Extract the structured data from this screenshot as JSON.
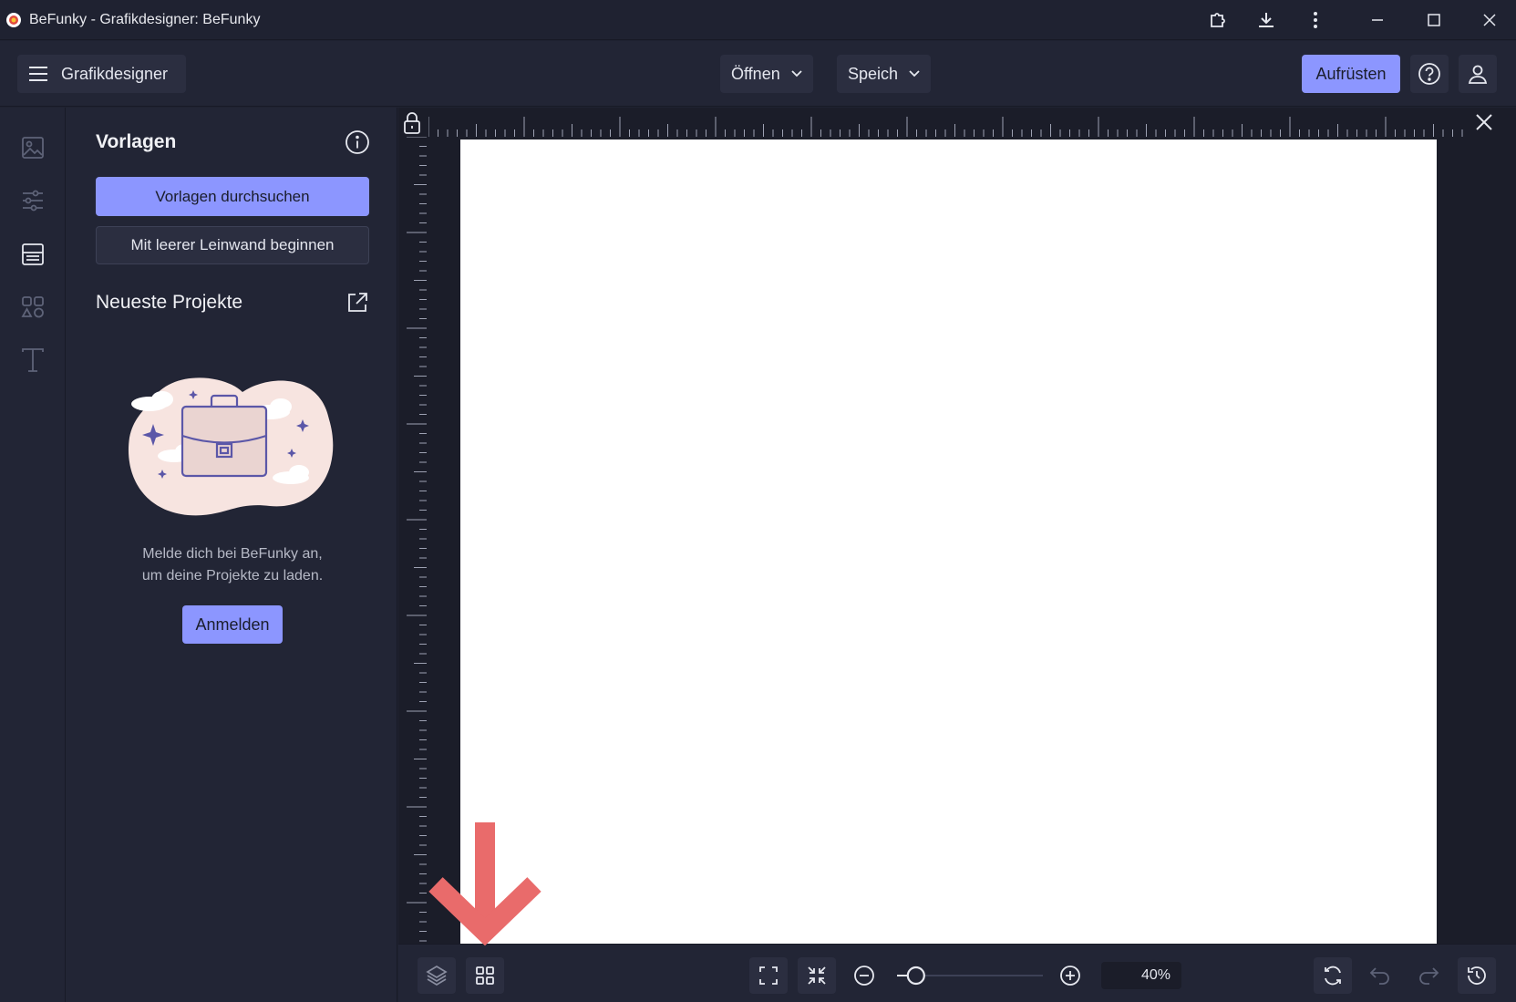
{
  "window": {
    "title": "BeFunky - Grafikdesigner: BeFunky"
  },
  "header": {
    "menu_label": "Grafikdesigner",
    "open_label": "Öffnen",
    "save_label": "Speich",
    "upgrade_label": "Aufrüsten"
  },
  "rail": {
    "items": [
      "image-icon",
      "sliders-icon",
      "templates-icon",
      "shapes-icon",
      "text-icon"
    ]
  },
  "panel": {
    "title": "Vorlagen",
    "browse_templates_label": "Vorlagen durchsuchen",
    "blank_canvas_label": "Mit leerer Leinwand beginnen",
    "recent_projects_title": "Neueste Projekte",
    "login_text_line1": "Melde dich bei BeFunky an,",
    "login_text_line2": "um deine Projekte zu laden.",
    "login_label": "Anmelden"
  },
  "bottombar": {
    "zoom_percent": "40%",
    "zoom_level": 0.13
  },
  "colors": {
    "accent": "#8c96ff",
    "background": "#1f2231",
    "panel": "#222535",
    "arrow": "#e96b6b"
  }
}
